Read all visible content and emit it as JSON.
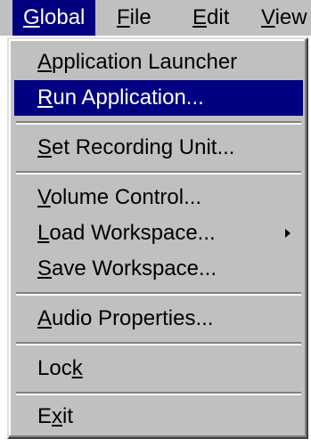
{
  "menubar": {
    "items": [
      {
        "label": "Global",
        "mnemonic": "G",
        "rest": "lobal"
      },
      {
        "label": "File",
        "mnemonic": "F",
        "rest": "ile"
      },
      {
        "label": "Edit",
        "mnemonic": "E",
        "rest": "dit"
      },
      {
        "label": "View",
        "mnemonic": "V",
        "rest": "iew"
      }
    ]
  },
  "menu": {
    "items": [
      {
        "pre": "",
        "mnemonic": "A",
        "rest": "pplication Launcher"
      },
      {
        "pre": "",
        "mnemonic": "R",
        "rest": "un Application..."
      },
      {
        "pre": "",
        "mnemonic": "S",
        "rest": "et Recording Unit..."
      },
      {
        "pre": "",
        "mnemonic": "V",
        "rest": "olume Control..."
      },
      {
        "pre": "",
        "mnemonic": "L",
        "rest": "oad Workspace..."
      },
      {
        "pre": "",
        "mnemonic": "S",
        "rest": "ave Workspace..."
      },
      {
        "pre": "",
        "mnemonic": "A",
        "rest": "udio Properties..."
      },
      {
        "pre": "Loc",
        "mnemonic": "k",
        "rest": ""
      },
      {
        "pre": "E",
        "mnemonic": "x",
        "rest": "it"
      }
    ],
    "highlighted_item": "Run Application...",
    "submenu_icon": "chevron-right-icon"
  },
  "colors": {
    "highlight": "#000080",
    "menu_face": "#c0c0c0"
  }
}
